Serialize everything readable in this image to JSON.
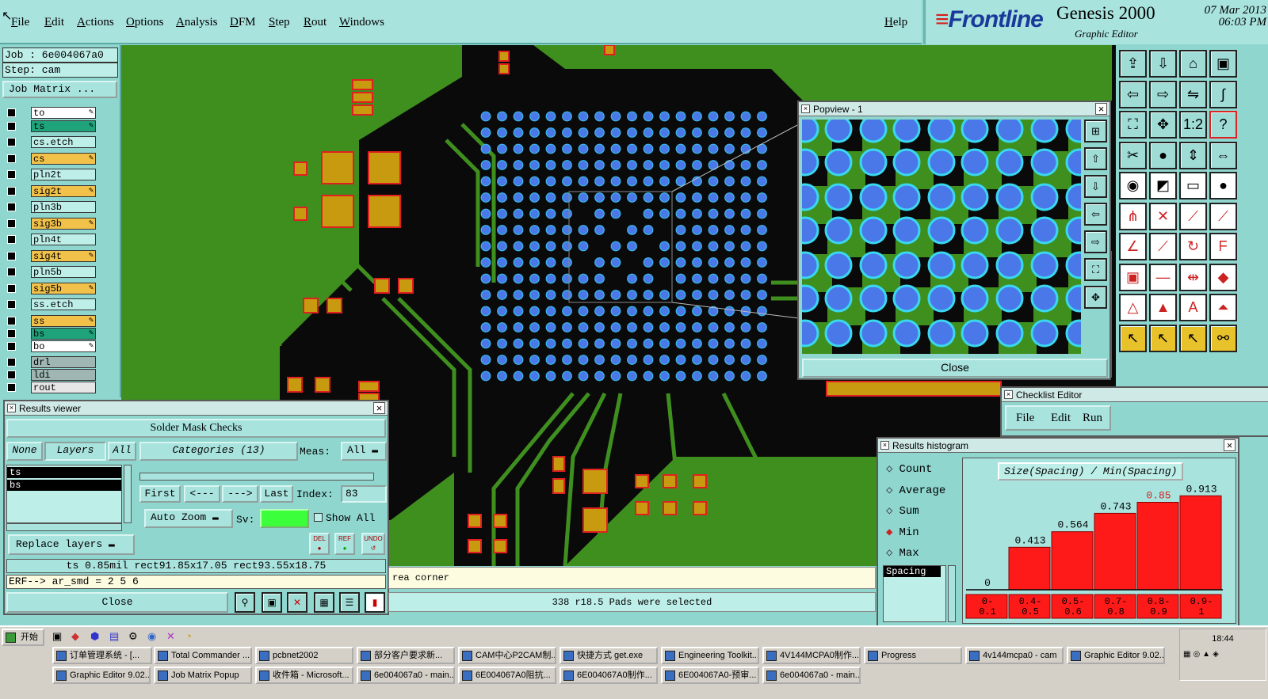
{
  "menu": {
    "items": [
      "File",
      "Edit",
      "Actions",
      "Options",
      "Analysis",
      "DFM",
      "Step",
      "Rout",
      "Windows"
    ],
    "help": "Help"
  },
  "brand": {
    "logo": "Frontline",
    "product": "Genesis 2000",
    "subtitle": "Graphic Editor",
    "date": "07 Mar 2013",
    "time": "06:03 PM"
  },
  "job": {
    "job_label": "Job : 6e004067a0",
    "step_label": "Step: cam",
    "matrix_button": "Job Matrix ..."
  },
  "layers": [
    {
      "name": "to",
      "color": "#ffffff",
      "pen": true
    },
    {
      "name": "ts",
      "color": "#1fa37a",
      "pen": true
    },
    {
      "name": "cs.etch",
      "color": "#bdeee8",
      "pen": false
    },
    {
      "name": "cs",
      "color": "#f2c14a",
      "pen": true
    },
    {
      "name": "pln2t",
      "color": "#bdeee8",
      "pen": false
    },
    {
      "name": "sig2t",
      "color": "#f2c14a",
      "pen": true
    },
    {
      "name": "pln3b",
      "color": "#bdeee8",
      "pen": false
    },
    {
      "name": "sig3b",
      "color": "#f2c14a",
      "pen": true
    },
    {
      "name": "pln4t",
      "color": "#bdeee8",
      "pen": false
    },
    {
      "name": "sig4t",
      "color": "#f2c14a",
      "pen": true
    },
    {
      "name": "pln5b",
      "color": "#bdeee8",
      "pen": false
    },
    {
      "name": "sig5b",
      "color": "#f2c14a",
      "pen": true
    },
    {
      "name": "ss.etch",
      "color": "#bdeee8",
      "pen": false
    },
    {
      "name": "ss",
      "color": "#f2c14a",
      "pen": true
    },
    {
      "name": "bs",
      "color": "#1fa37a",
      "pen": true
    },
    {
      "name": "bo",
      "color": "#ffffff",
      "pen": true
    },
    {
      "name": "drl",
      "color": "#9fb6b3",
      "pen": false
    },
    {
      "name": "ldi",
      "color": "#9fb6b3",
      "pen": false
    },
    {
      "name": "rout",
      "color": "#e6e6e6",
      "pen": false
    }
  ],
  "popview": {
    "title": "Popview - 1",
    "close": "Close"
  },
  "checklist": {
    "title": "Checklist Editor",
    "menu": [
      "File",
      "Edit",
      "Run"
    ]
  },
  "histogram": {
    "title": "Results histogram",
    "modes": [
      {
        "label": "Count",
        "selected": false
      },
      {
        "label": "Average",
        "selected": false
      },
      {
        "label": "Sum",
        "selected": false
      },
      {
        "label": "Min",
        "selected": true
      },
      {
        "label": "Max",
        "selected": false
      }
    ],
    "list_item": "Spacing",
    "heading": "Size(Spacing) / Min(Spacing)",
    "highlight_color": "#d62020"
  },
  "chart_data": {
    "type": "bar",
    "title": "Size(Spacing) / Min(Spacing)",
    "categories": [
      "0-\n0.1",
      "0.4-\n0.5",
      "0.5-\n0.6",
      "0.7-\n0.8",
      "0.8-\n0.9",
      "0.9-\n1"
    ],
    "values": [
      0,
      0.413,
      0.564,
      0.743,
      0.85,
      0.913
    ],
    "value_labels": [
      "0",
      "0.413",
      "0.564",
      "0.743",
      "0.85",
      "0.913"
    ],
    "highlight_index": 4,
    "ylim": [
      0,
      1
    ]
  },
  "results": {
    "title": "Results viewer",
    "header": "Solder Mask Checks",
    "tab_none": "None",
    "tab_layers": "Layers",
    "tab_all": "All",
    "categories": "Categories (13)",
    "meas_label": "Meas:",
    "meas_value": "All",
    "layer_list": [
      "ts",
      "bs"
    ],
    "first": "First",
    "prev": "<---",
    "next": "--->",
    "last": "Last",
    "index_label": "Index:",
    "index_value": "83",
    "auto_zoom": "Auto Zoom",
    "sv_label": "Sv:",
    "show_all": "Show All",
    "replace_layers": "Replace layers",
    "del": "DEL",
    "ref": "REF",
    "undo": "UNDO",
    "measure_line": "ts 0.85mil  rect91.85x17.05  rect93.55x18.75",
    "erf_line": "ERF--> ar_smd = 2 5 6",
    "close": "Close"
  },
  "status": {
    "message": "rea corner",
    "selection": "338 r18.5 Pads were selected"
  },
  "taskbar": {
    "start": "开始",
    "clock": "18:44",
    "row1": [
      "订单管理系统 - [...",
      "Total Commander ...",
      "pcbnet2002",
      "部分客户要求新...",
      "CAM中心P2CAM制...",
      "快捷方式 get.exe",
      "Engineering Toolkit...",
      "4V144MCPA0制作...",
      "Progress",
      "4v144mcpa0 - cam",
      "Graphic Editor 9.02..."
    ],
    "row2": [
      "Graphic Editor 9.02...",
      "Job Matrix Popup",
      "收件箱 - Microsoft...",
      "6e004067a0 - main...",
      "6E004067A0阻抗...",
      "6E004067A0制作...",
      "6E004067A0-预审...",
      "6e004067a0 - main..."
    ]
  }
}
